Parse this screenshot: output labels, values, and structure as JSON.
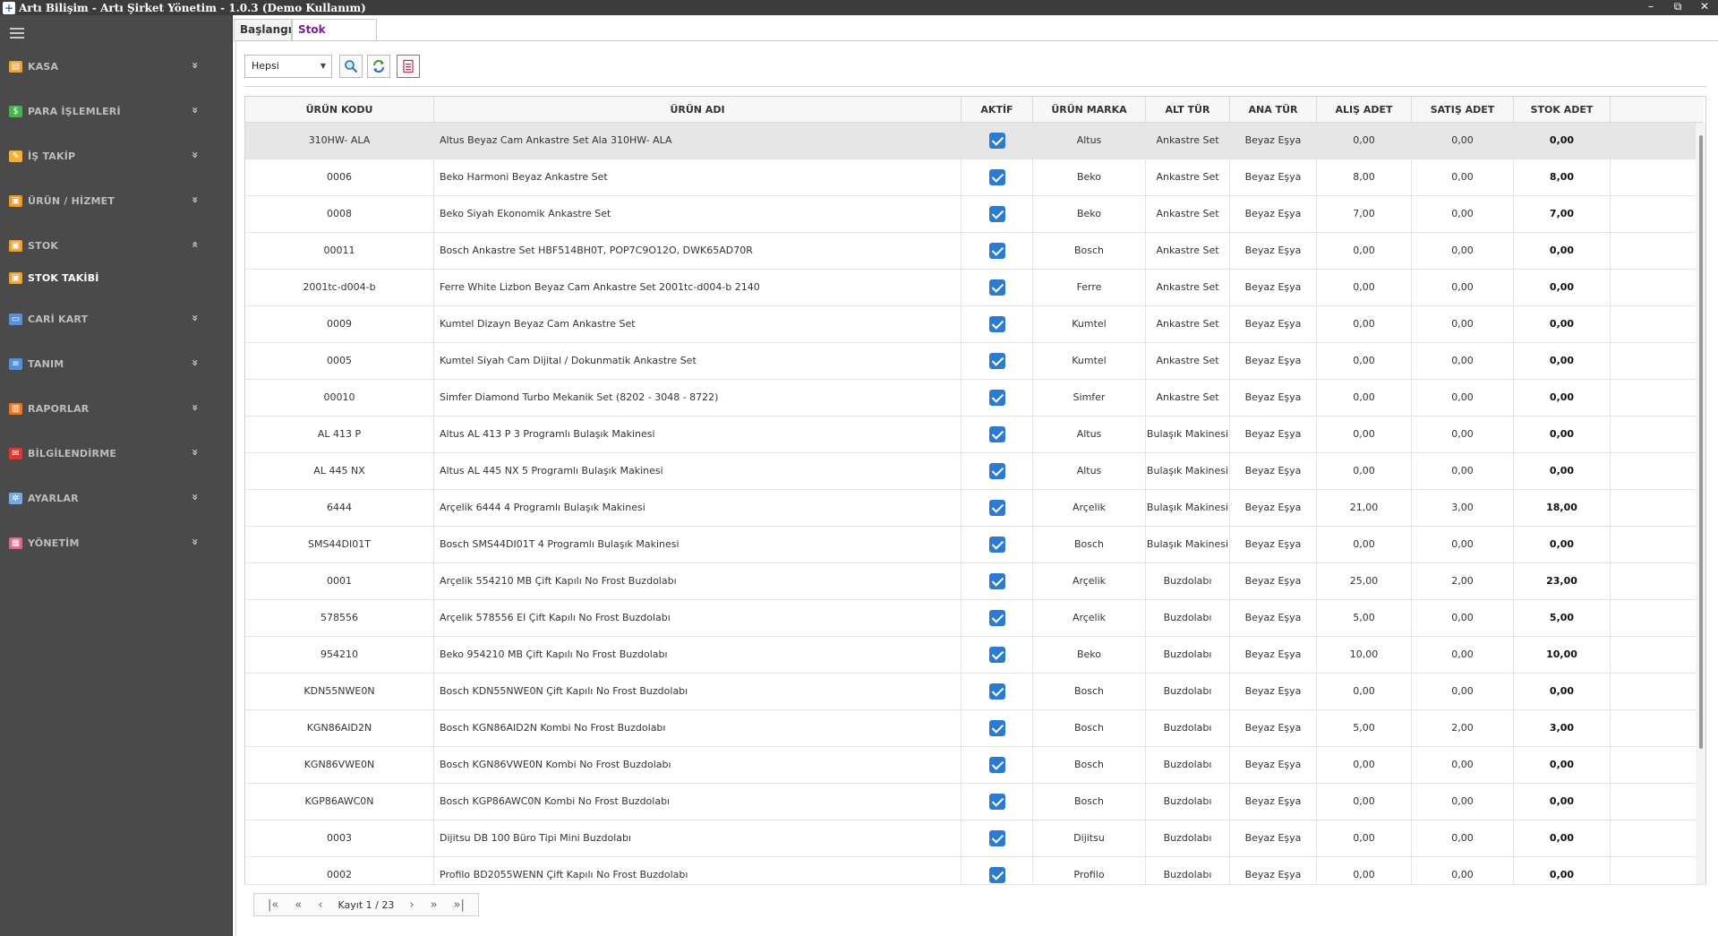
{
  "window": {
    "title": "Artı Bilişim - Artı Şirket Yönetim - 1.0.3 (Demo Kullanım)",
    "controls": [
      "–",
      "⧉",
      "✕"
    ]
  },
  "sidebar": {
    "items": [
      {
        "label": "KASA",
        "icon": "cash-register-icon",
        "color": "#e8a33d",
        "chevron": "»"
      },
      {
        "label": "PARA İŞLEMLERİ",
        "icon": "money-icon",
        "color": "#4caf50",
        "chevron": "»"
      },
      {
        "label": "İŞ TAKİP",
        "icon": "pencil-icon",
        "color": "#f0b040",
        "chevron": "»"
      },
      {
        "label": "ÜRÜN / HİZMET",
        "icon": "box-icon",
        "color": "#e89a2a",
        "chevron": "»"
      },
      {
        "label": "STOK",
        "icon": "stock-icon",
        "color": "#e8a33d",
        "chevron": "«"
      },
      {
        "label": "STOK TAKİBİ",
        "icon": "stock-tracking-icon",
        "color": "#e8a33d",
        "chevron": ""
      },
      {
        "label": "CARİ KART",
        "icon": "id-card-icon",
        "color": "#5a8fd8",
        "chevron": "»"
      },
      {
        "label": "TANIM",
        "icon": "list-icon",
        "color": "#5a8fd8",
        "chevron": "»"
      },
      {
        "label": "RAPORLAR",
        "icon": "bar-chart-icon",
        "color": "#e07a2a",
        "chevron": "»"
      },
      {
        "label": "BİLGİLENDİRME",
        "icon": "mail-icon",
        "color": "#d83a3a",
        "chevron": "»"
      },
      {
        "label": "AYARLAR",
        "icon": "gear-icon",
        "color": "#7aa8e0",
        "chevron": "»"
      },
      {
        "label": "YÖNETİM",
        "icon": "users-icon",
        "color": "#d86a8a",
        "chevron": "»"
      }
    ]
  },
  "tabs": [
    {
      "label": "Başlangıç"
    },
    {
      "label": "Stok Takibi",
      "close": "×"
    }
  ],
  "toolbar": {
    "filter_value": "Hepsi",
    "filter_caret": "▼",
    "buttons": [
      "search-icon",
      "refresh-icon",
      "export-icon"
    ]
  },
  "grid": {
    "columns": [
      "ÜRÜN KODU",
      "ÜRÜN ADI",
      "AKTİF",
      "ÜRÜN MARKA",
      "ALT TÜR",
      "ANA TÜR",
      "ALIŞ ADET",
      "SATIŞ ADET",
      "STOK ADET"
    ],
    "rows": [
      {
        "kod": "310HW- ALA",
        "adi": "Altus Beyaz Cam Ankastre Set Ala 310HW- ALA",
        "aktif": true,
        "marka": "Altus",
        "alt": "Ankastre Set",
        "ana": "Beyaz Eşya",
        "alis": "0,00",
        "satis": "0,00",
        "stok": "0,00"
      },
      {
        "kod": "0006",
        "adi": "Beko Harmoni Beyaz Ankastre Set",
        "aktif": true,
        "marka": "Beko",
        "alt": "Ankastre Set",
        "ana": "Beyaz Eşya",
        "alis": "8,00",
        "satis": "0,00",
        "stok": "8,00"
      },
      {
        "kod": "0008",
        "adi": "Beko Siyah Ekonomik Ankastre Set",
        "aktif": true,
        "marka": "Beko",
        "alt": "Ankastre Set",
        "ana": "Beyaz Eşya",
        "alis": "7,00",
        "satis": "0,00",
        "stok": "7,00"
      },
      {
        "kod": "00011",
        "adi": "Bosch Ankastre Set HBF514BH0T, POP7C9O12O, DWK65AD70R",
        "aktif": true,
        "marka": "Bosch",
        "alt": "Ankastre Set",
        "ana": "Beyaz Eşya",
        "alis": "0,00",
        "satis": "0,00",
        "stok": "0,00"
      },
      {
        "kod": "2001tc-d004-b",
        "adi": "Ferre White Lizbon Beyaz Cam Ankastre Set 2001tc-d004-b 2140",
        "aktif": true,
        "marka": "Ferre",
        "alt": "Ankastre Set",
        "ana": "Beyaz Eşya",
        "alis": "0,00",
        "satis": "0,00",
        "stok": "0,00"
      },
      {
        "kod": "0009",
        "adi": "Kumtel Dizayn Beyaz Cam Ankastre Set",
        "aktif": true,
        "marka": "Kumtel",
        "alt": "Ankastre Set",
        "ana": "Beyaz Eşya",
        "alis": "0,00",
        "satis": "0,00",
        "stok": "0,00"
      },
      {
        "kod": "0005",
        "adi": "Kumtel Siyah Cam Dijital / Dokunmatik Ankastre Set",
        "aktif": true,
        "marka": "Kumtel",
        "alt": "Ankastre Set",
        "ana": "Beyaz Eşya",
        "alis": "0,00",
        "satis": "0,00",
        "stok": "0,00"
      },
      {
        "kod": "00010",
        "adi": "Simfer Diamond Turbo Mekanik Set (8202 - 3048 - 8722)",
        "aktif": true,
        "marka": "Simfer",
        "alt": "Ankastre Set",
        "ana": "Beyaz Eşya",
        "alis": "0,00",
        "satis": "0,00",
        "stok": "0,00"
      },
      {
        "kod": "AL 413 P",
        "adi": "Altus AL 413 P 3 Programlı Bulaşık Makinesi",
        "aktif": true,
        "marka": "Altus",
        "alt": "Bulaşık Makinesi",
        "ana": "Beyaz Eşya",
        "alis": "0,00",
        "satis": "0,00",
        "stok": "0,00"
      },
      {
        "kod": "AL 445 NX",
        "adi": "Altus AL 445 NX 5 Programlı Bulaşık Makinesi",
        "aktif": true,
        "marka": "Altus",
        "alt": "Bulaşık Makinesi",
        "ana": "Beyaz Eşya",
        "alis": "0,00",
        "satis": "0,00",
        "stok": "0,00"
      },
      {
        "kod": "6444",
        "adi": "Arçelik 6444 4 Programlı Bulaşık Makinesi",
        "aktif": true,
        "marka": "Arçelik",
        "alt": "Bulaşık Makinesi",
        "ana": "Beyaz Eşya",
        "alis": "21,00",
        "satis": "3,00",
        "stok": "18,00"
      },
      {
        "kod": "SMS44DI01T",
        "adi": "Bosch SMS44DI01T 4 Programlı Bulaşık Makinesi",
        "aktif": true,
        "marka": "Bosch",
        "alt": "Bulaşık Makinesi",
        "ana": "Beyaz Eşya",
        "alis": "0,00",
        "satis": "0,00",
        "stok": "0,00"
      },
      {
        "kod": "0001",
        "adi": "Arçelik 554210 MB Çift Kapılı No Frost Buzdolabı",
        "aktif": true,
        "marka": "Arçelik",
        "alt": "Buzdolabı",
        "ana": "Beyaz Eşya",
        "alis": "25,00",
        "satis": "2,00",
        "stok": "23,00"
      },
      {
        "kod": "578556",
        "adi": "Arçelik 578556 EI Çift Kapılı No Frost Buzdolabı",
        "aktif": true,
        "marka": "Arçelik",
        "alt": "Buzdolabı",
        "ana": "Beyaz Eşya",
        "alis": "5,00",
        "satis": "0,00",
        "stok": "5,00"
      },
      {
        "kod": "954210",
        "adi": "Beko 954210 MB Çift Kapılı No Frost Buzdolabı",
        "aktif": true,
        "marka": "Beko",
        "alt": "Buzdolabı",
        "ana": "Beyaz Eşya",
        "alis": "10,00",
        "satis": "0,00",
        "stok": "10,00"
      },
      {
        "kod": "KDN55NWE0N",
        "adi": "Bosch KDN55NWE0N Çift Kapılı No Frost Buzdolabı",
        "aktif": true,
        "marka": "Bosch",
        "alt": "Buzdolabı",
        "ana": "Beyaz Eşya",
        "alis": "0,00",
        "satis": "0,00",
        "stok": "0,00"
      },
      {
        "kod": "KGN86AID2N",
        "adi": "Bosch KGN86AID2N Kombi No Frost Buzdolabı",
        "aktif": true,
        "marka": "Bosch",
        "alt": "Buzdolabı",
        "ana": "Beyaz Eşya",
        "alis": "5,00",
        "satis": "2,00",
        "stok": "3,00"
      },
      {
        "kod": "KGN86VWE0N",
        "adi": "Bosch KGN86VWE0N Kombi No Frost Buzdolabı",
        "aktif": true,
        "marka": "Bosch",
        "alt": "Buzdolabı",
        "ana": "Beyaz Eşya",
        "alis": "0,00",
        "satis": "0,00",
        "stok": "0,00"
      },
      {
        "kod": "KGP86AWC0N",
        "adi": "Bosch KGP86AWC0N Kombi No Frost Buzdolabı",
        "aktif": true,
        "marka": "Bosch",
        "alt": "Buzdolabı",
        "ana": "Beyaz Eşya",
        "alis": "0,00",
        "satis": "0,00",
        "stok": "0,00"
      },
      {
        "kod": "0003",
        "adi": "Dijitsu DB 100 Büro Tipi Mini Buzdolabı",
        "aktif": true,
        "marka": "Dijitsu",
        "alt": "Buzdolabı",
        "ana": "Beyaz Eşya",
        "alis": "0,00",
        "satis": "0,00",
        "stok": "0,00"
      },
      {
        "kod": "0002",
        "adi": "Profilo BD2055WENN Çift Kapılı No Frost Buzdolabı",
        "aktif": true,
        "marka": "Profilo",
        "alt": "Buzdolabı",
        "ana": "Beyaz Eşya",
        "alis": "0,00",
        "satis": "0,00",
        "stok": "0,00"
      }
    ]
  },
  "pager": {
    "first": "|«",
    "prev_page": "«",
    "prev": "‹",
    "info": "Kayıt 1 / 23",
    "next": "›",
    "next_page": "»",
    "last": "»|"
  }
}
